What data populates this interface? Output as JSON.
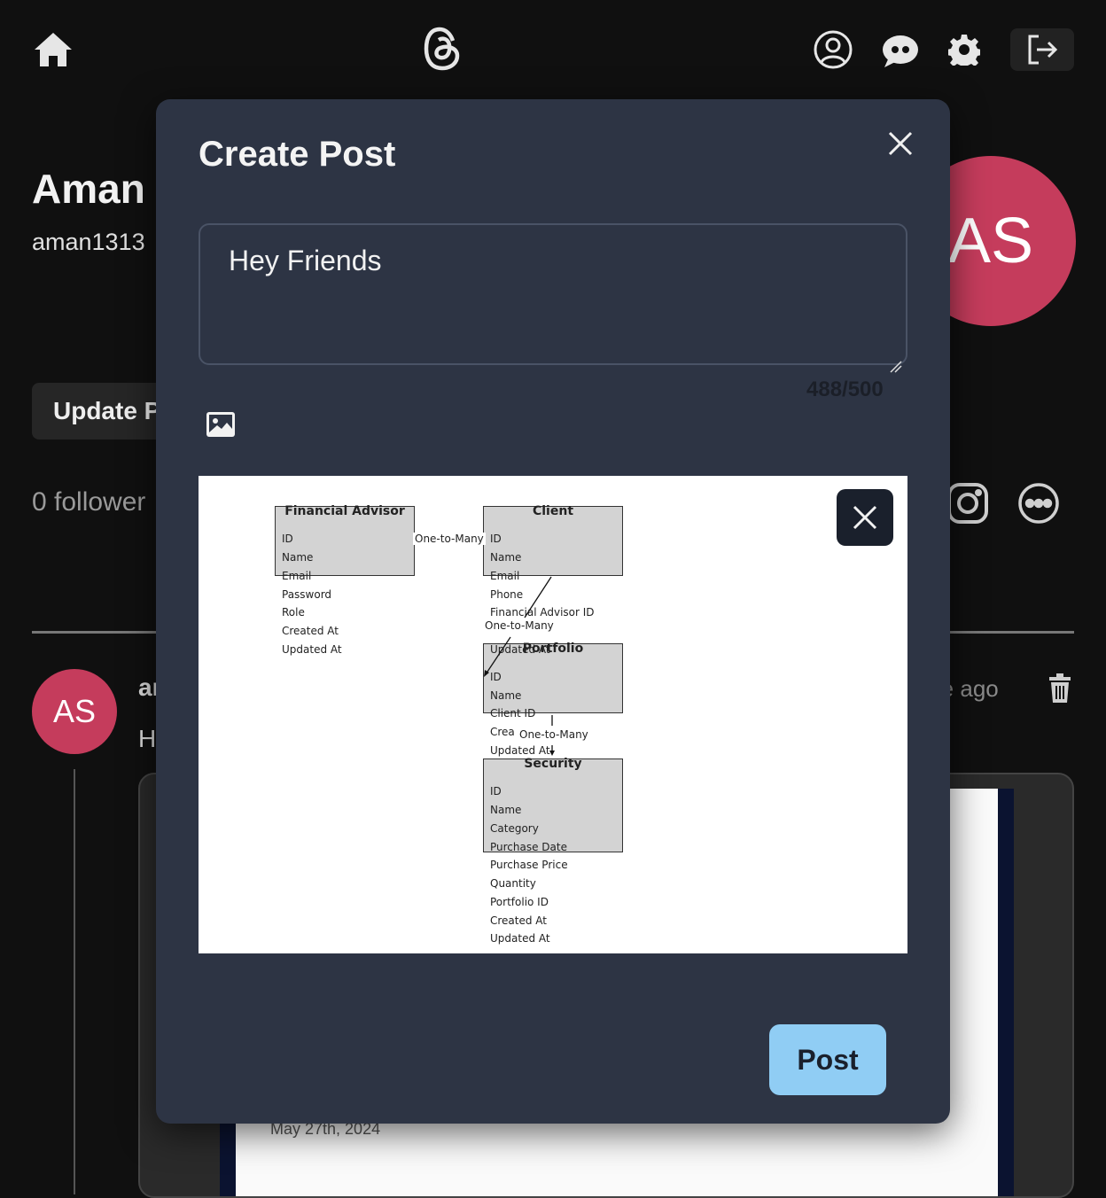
{
  "topbar": {
    "home_icon": "home-icon",
    "logo_icon": "threads-logo-icon",
    "profile_icon": "user-circle-icon",
    "chat_icon": "chat-bubbles-icon",
    "settings_icon": "gear-icon",
    "logout_icon": "logout-icon"
  },
  "profile": {
    "name": "Aman",
    "handle": "aman1313",
    "avatar_initials": "AS",
    "update_button": "Update P",
    "followers": "0 follower"
  },
  "post": {
    "avatar_initials": "AS",
    "username": "ar",
    "text": "H",
    "time": "ute ago",
    "date": "May 27th, 2024"
  },
  "modal": {
    "title": "Create Post",
    "text_value": "Hey Friends",
    "char_count": "488/500",
    "post_button": "Post"
  },
  "diagram": {
    "entities": {
      "advisor": {
        "title": "Financial Advisor",
        "fields": [
          "ID",
          "Name",
          "Email",
          "Password",
          "Role",
          "Created At",
          "Updated At"
        ]
      },
      "client": {
        "title": "Client",
        "fields": [
          "ID",
          "Name",
          "Email",
          "Phone",
          "Financial Advisor ID",
          "Updated At"
        ]
      },
      "portfolio": {
        "title": "Portfolio",
        "fields": [
          "ID",
          "Name",
          "Client ID",
          "Crea",
          "Updated At"
        ]
      },
      "security": {
        "title": "Security",
        "fields": [
          "ID",
          "Name",
          "Category",
          "Purchase Date",
          "Purchase Price",
          "Quantity",
          "Portfolio ID",
          "Created At",
          "Updated At"
        ]
      }
    },
    "relations": {
      "advisor_client": "One-to-Many",
      "client_portfolio": "One-to-Many",
      "portfolio_security": "One-to-Many"
    }
  },
  "colors": {
    "modal_bg": "#2d3444",
    "post_button": "#90cdf4",
    "avatar": "#c53c5c"
  }
}
